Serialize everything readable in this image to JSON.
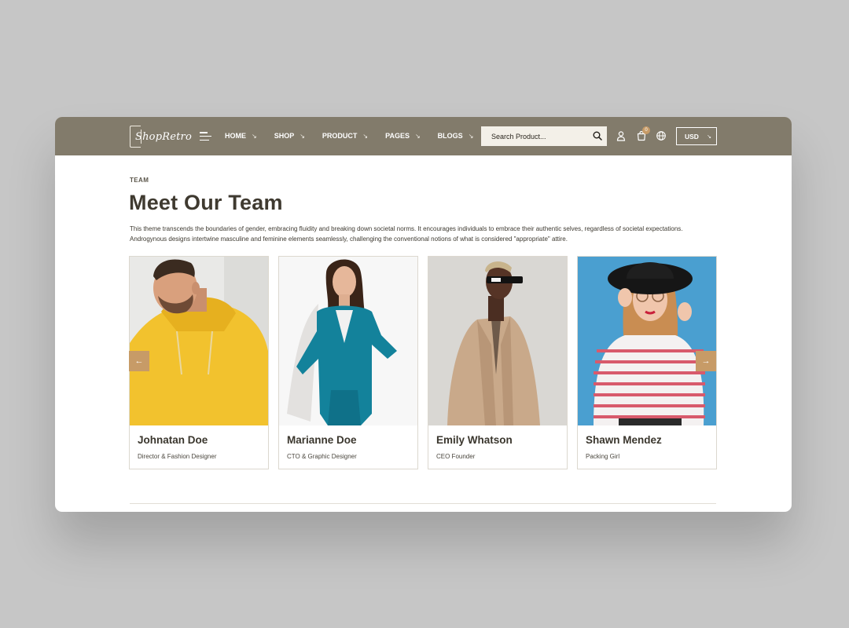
{
  "header": {
    "logo_text": "ShopRetro",
    "nav": [
      {
        "label": "HOME",
        "arrow": "↘"
      },
      {
        "label": "SHOP",
        "arrow": "↘"
      },
      {
        "label": "PRODUCT",
        "arrow": "↘"
      },
      {
        "label": "PAGES",
        "arrow": "↘"
      },
      {
        "label": "BLOGS",
        "arrow": "↘"
      }
    ],
    "search_placeholder": "Search Product...",
    "cart_count": "0",
    "currency": "USD",
    "currency_arrow": "↘"
  },
  "main": {
    "eyebrow": "TEAM",
    "title": "Meet Our Team",
    "intro": "This theme transcends the boundaries of gender, embracing fluidity and breaking down societal norms. It encourages individuals to embrace their authentic selves, regardless of societal expectations. Androgynous designs intertwine masculine and feminine elements seamlessly, challenging the conventional notions of what is considered \"appropriate\" attire.",
    "team": [
      {
        "name": "Johnatan Doe",
        "role": "Director & Fashion Designer"
      },
      {
        "name": "Marianne Doe",
        "role": "CTO & Graphic Designer"
      },
      {
        "name": "Emily Whatson",
        "role": "CEO Founder"
      },
      {
        "name": "Shawn Mendez",
        "role": "Packing Girl"
      }
    ],
    "prev_arrow": "←",
    "next_arrow": "→"
  },
  "colors": {
    "header_bg": "#827b6b",
    "accent": "#c79b67",
    "page_bg": "#c6c6c6",
    "title_text": "#3f3a30"
  },
  "icons": [
    "menu-icon",
    "search-icon",
    "user-icon",
    "cart-icon",
    "globe-icon",
    "arrow-left-icon",
    "arrow-right-icon"
  ]
}
